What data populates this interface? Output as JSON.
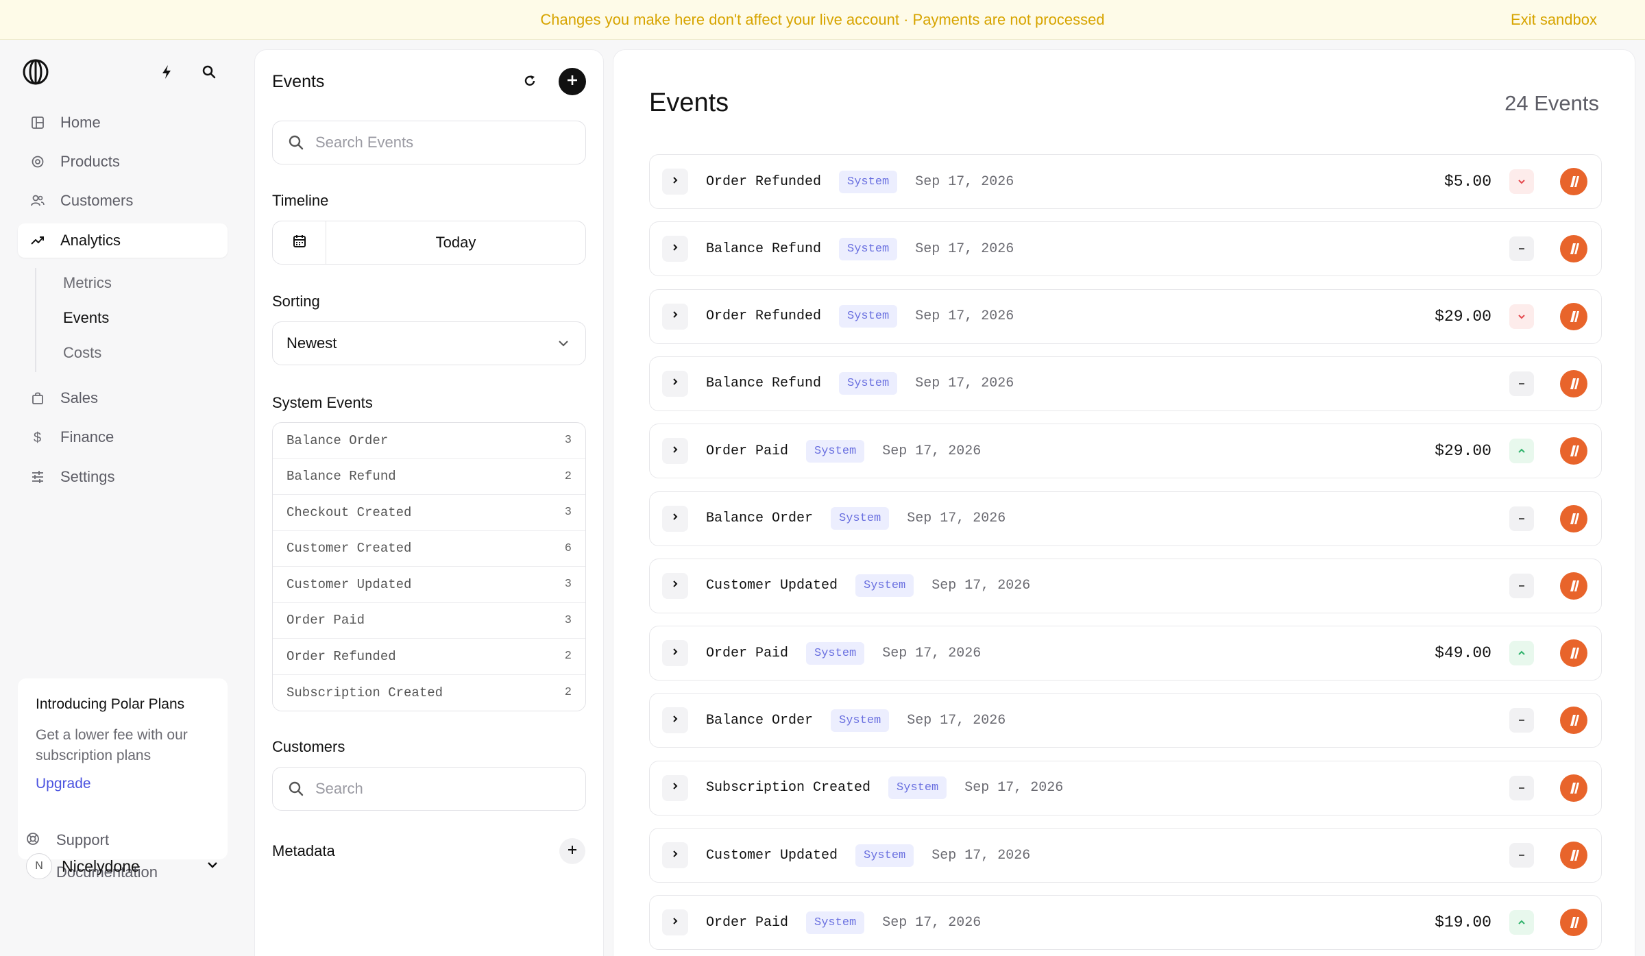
{
  "banner": {
    "text": "Changes you make here don't affect your live account · Payments are not processed",
    "exit_label": "Exit sandbox"
  },
  "sidebar": {
    "items": [
      {
        "label": "Home",
        "icon": "grid-icon"
      },
      {
        "label": "Products",
        "icon": "hexagon-icon"
      },
      {
        "label": "Customers",
        "icon": "users-icon"
      },
      {
        "label": "Analytics",
        "icon": "trending-up-icon",
        "active": true
      },
      {
        "label": "Sales",
        "icon": "shopping-bag-icon"
      },
      {
        "label": "Finance",
        "icon": "dollar-icon"
      },
      {
        "label": "Settings",
        "icon": "sliders-icon"
      }
    ],
    "sub_items": [
      {
        "label": "Metrics"
      },
      {
        "label": "Events",
        "active": true
      },
      {
        "label": "Costs"
      }
    ],
    "promo": {
      "title": "Introducing Polar Plans",
      "text": "Get a lower fee with our subscription plans",
      "link": "Upgrade"
    },
    "footer": [
      {
        "label": "Support",
        "icon": "support-icon"
      },
      {
        "label": "Documentation",
        "icon": "arrow-up-right-icon"
      }
    ],
    "account": {
      "initial": "N",
      "name": "Nicelydone"
    }
  },
  "filters": {
    "title": "Events",
    "search_placeholder": "Search Events",
    "timeline_label": "Timeline",
    "timeline_value": "Today",
    "sorting_label": "Sorting",
    "sorting_value": "Newest",
    "system_events_label": "System Events",
    "system_events": [
      {
        "name": "Balance Order",
        "count": "3"
      },
      {
        "name": "Balance Refund",
        "count": "2"
      },
      {
        "name": "Checkout Created",
        "count": "3"
      },
      {
        "name": "Customer Created",
        "count": "6"
      },
      {
        "name": "Customer Updated",
        "count": "3"
      },
      {
        "name": "Order Paid",
        "count": "3"
      },
      {
        "name": "Order Refunded",
        "count": "2"
      },
      {
        "name": "Subscription Created",
        "count": "2"
      }
    ],
    "customers_label": "Customers",
    "customers_placeholder": "Search",
    "metadata_label": "Metadata"
  },
  "main": {
    "title": "Events",
    "count_label": "24 Events",
    "events": [
      {
        "name": "Order Refunded",
        "badge": "System",
        "date": "Sep 17, 2026",
        "amount": "$5.00",
        "indicator": "down"
      },
      {
        "name": "Balance Refund",
        "badge": "System",
        "date": "Sep 17, 2026",
        "amount": "",
        "indicator": "neutral"
      },
      {
        "name": "Order Refunded",
        "badge": "System",
        "date": "Sep 17, 2026",
        "amount": "$29.00",
        "indicator": "down"
      },
      {
        "name": "Balance Refund",
        "badge": "System",
        "date": "Sep 17, 2026",
        "amount": "",
        "indicator": "neutral"
      },
      {
        "name": "Order Paid",
        "badge": "System",
        "date": "Sep 17, 2026",
        "amount": "$29.00",
        "indicator": "up"
      },
      {
        "name": "Balance Order",
        "badge": "System",
        "date": "Sep 17, 2026",
        "amount": "",
        "indicator": "neutral"
      },
      {
        "name": "Customer Updated",
        "badge": "System",
        "date": "Sep 17, 2026",
        "amount": "",
        "indicator": "neutral"
      },
      {
        "name": "Order Paid",
        "badge": "System",
        "date": "Sep 17, 2026",
        "amount": "$49.00",
        "indicator": "up"
      },
      {
        "name": "Balance Order",
        "badge": "System",
        "date": "Sep 17, 2026",
        "amount": "",
        "indicator": "neutral"
      },
      {
        "name": "Subscription Created",
        "badge": "System",
        "date": "Sep 17, 2026",
        "amount": "",
        "indicator": "neutral"
      },
      {
        "name": "Customer Updated",
        "badge": "System",
        "date": "Sep 17, 2026",
        "amount": "",
        "indicator": "neutral"
      },
      {
        "name": "Order Paid",
        "badge": "System",
        "date": "Sep 17, 2026",
        "amount": "$19.00",
        "indicator": "up"
      }
    ]
  },
  "colors": {
    "accent": "#4c54e0",
    "banner_text": "#d7a400",
    "avatar": "#e8642b",
    "badge_text": "#6a70e0"
  }
}
